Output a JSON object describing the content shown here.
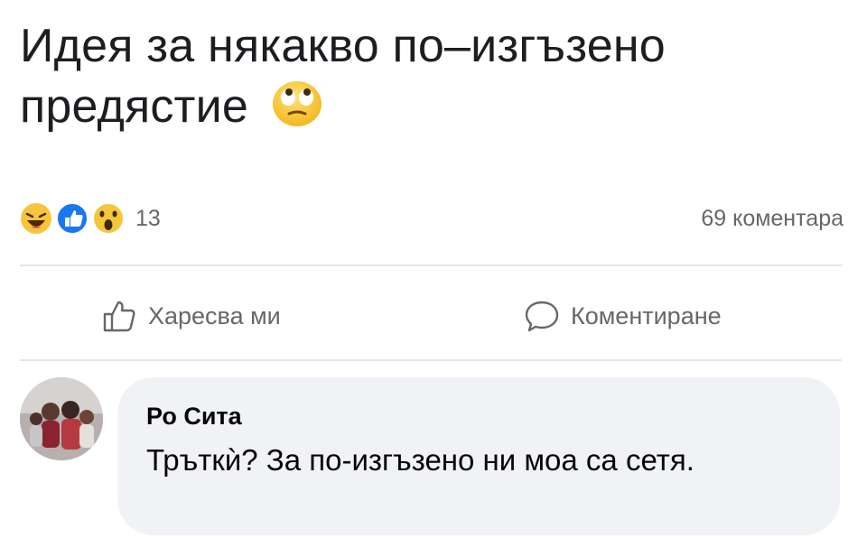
{
  "post": {
    "text": "Идея за някакво по–изгъзено предястие",
    "emoji": "face-with-rolling-eyes-emoji"
  },
  "reactions": {
    "icons": [
      "laughing-reaction-icon",
      "like-reaction-icon",
      "wow-reaction-icon"
    ],
    "count": "13",
    "comments_count": "69 коментара"
  },
  "actions": {
    "like_label": "Харесва ми",
    "comment_label": "Коментиране"
  },
  "comment": {
    "author": "Ро Сита",
    "text": "Тръткѝ? За по-изгъзено ни моа са сетя."
  },
  "colors": {
    "text": "#1c1e21",
    "muted": "#65676b",
    "bubble": "#f0f2f5",
    "like_blue": "#1877f2",
    "emoji_yellow": "#f7c53c"
  }
}
